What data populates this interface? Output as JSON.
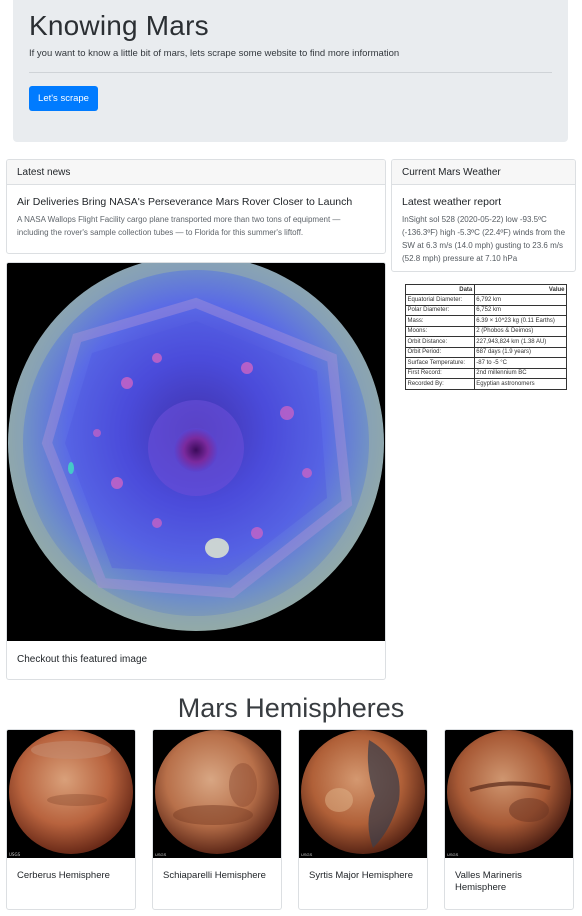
{
  "header": {
    "title": "Knowing Mars",
    "lead": "If you want to know a little bit of mars, lets scrape some website to find more information",
    "button_label": "Let's scrape"
  },
  "news": {
    "header": "Latest news",
    "title": "Air Deliveries Bring NASA's Perseverance Mars Rover Closer to Launch",
    "body": "A NASA Wallops Flight Facility cargo plane transported more than two tons of equipment — including the rover's sample collection tubes — to Florida for this summer's liftoff."
  },
  "weather": {
    "header": "Current Mars Weather",
    "title": "Latest weather report",
    "body": "InSight sol 528 (2020-05-22) low -93.5ºC (-136.3ºF) high -5.3ºC (22.4ºF) winds from the SW at 6.3 m/s (14.0 mph) gusting to 23.6 m/s (52.8 mph) pressure at 7.10 hPa"
  },
  "facts": {
    "col_label": "Data",
    "col_value": "Value",
    "rows": [
      {
        "label": "Equatorial Diameter:",
        "value": "6,792 km"
      },
      {
        "label": "Polar Diameter:",
        "value": "6,752 km"
      },
      {
        "label": "Mass:",
        "value": "6.39 × 10^23 kg (0.11 Earths)"
      },
      {
        "label": "Moons:",
        "value": "2 (Phobos & Deimos)"
      },
      {
        "label": "Orbit Distance:",
        "value": "227,943,824 km (1.38 AU)"
      },
      {
        "label": "Orbit Period:",
        "value": "687 days (1.9 years)"
      },
      {
        "label": "Surface Temperature:",
        "value": "-87 to -5 °C"
      },
      {
        "label": "First Record:",
        "value": "2nd millennium BC"
      },
      {
        "label": "Recorded By:",
        "value": "Egyptian astronomers"
      }
    ]
  },
  "featured": {
    "caption": "Checkout this featured image"
  },
  "hemispheres": {
    "heading": "Mars Hemispheres",
    "watermark": "USGS",
    "items": [
      {
        "title": "Cerberus Hemisphere"
      },
      {
        "title": "Schiaparelli Hemisphere"
      },
      {
        "title": "Syrtis Major Hemisphere"
      },
      {
        "title": "Valles Marineris Hemisphere"
      }
    ]
  },
  "colors": {
    "accent": "#007bff",
    "jumbotron_bg": "#e9ecef",
    "card_header_bg": "#f7f7f7"
  }
}
